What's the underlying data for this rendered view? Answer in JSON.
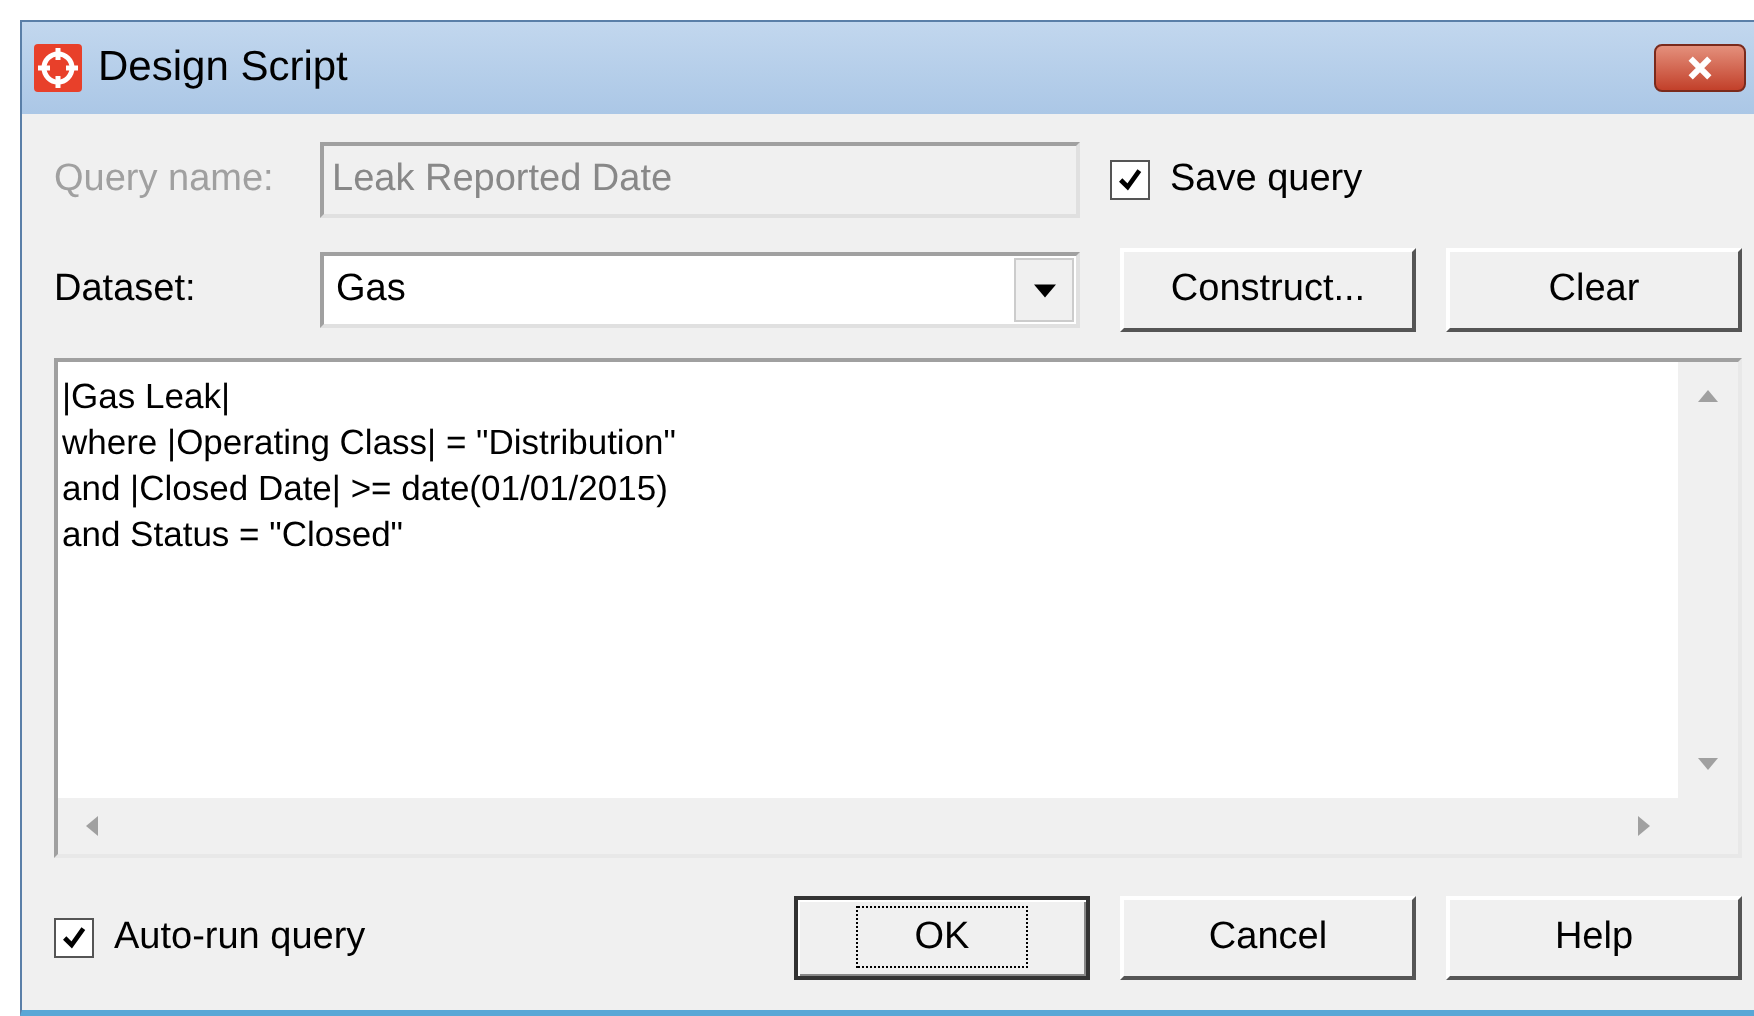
{
  "window": {
    "title": "Design Script"
  },
  "query_name": {
    "label": "Query name:",
    "value": "Leak Reported Date",
    "disabled": true
  },
  "save_query": {
    "label": "Save query",
    "checked": true
  },
  "dataset": {
    "label": "Dataset:",
    "value": "Gas"
  },
  "dataset_buttons": [
    {
      "label": "Construct..."
    },
    {
      "label": "Clear"
    }
  ],
  "script": {
    "lines": [
      "|Gas Leak|",
      "where |Operating Class| = \"Distribution\"",
      "and |Closed Date| >= date(01/01/2015)",
      "and Status = \"Closed\""
    ]
  },
  "auto_run": {
    "label": "Auto-run query",
    "checked": true
  },
  "buttons": [
    {
      "label": "OK",
      "default": true
    },
    {
      "label": "Cancel",
      "default": false
    },
    {
      "label": "Help",
      "default": false
    }
  ]
}
